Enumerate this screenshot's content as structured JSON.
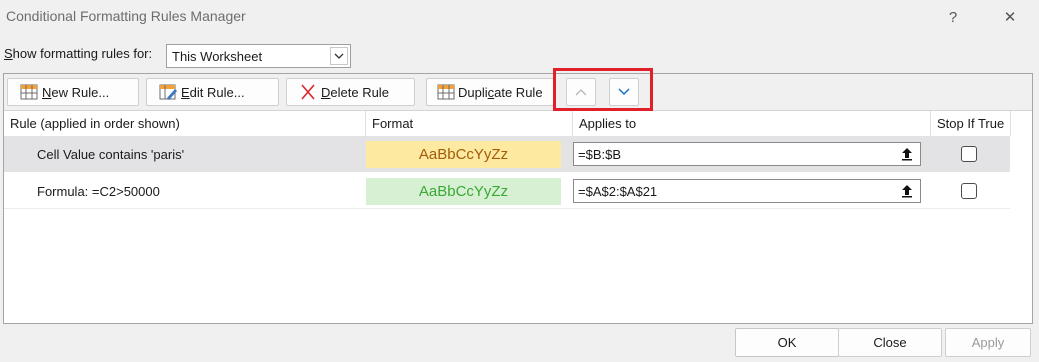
{
  "window": {
    "title": "Conditional Formatting Rules Manager",
    "help_label": "?",
    "close_label": "✕"
  },
  "scope": {
    "label_prefix": "",
    "label_accel": "S",
    "label_rest": "how formatting rules for:",
    "selected": "This Worksheet"
  },
  "toolbar": {
    "new_rule": {
      "accel": "N",
      "rest": "ew Rule..."
    },
    "edit_rule": {
      "accel": "E",
      "rest": "dit Rule..."
    },
    "delete_rule": {
      "accel": "D",
      "rest": "elete Rule"
    },
    "duplicate_rule": {
      "pre": "Dupli",
      "accel": "c",
      "rest": "ate Rule"
    }
  },
  "table": {
    "headers": {
      "rule": "Rule (applied in order shown)",
      "format": "Format",
      "applies_to": "Applies to",
      "stop": "Stop If True"
    },
    "rows": [
      {
        "rule": "Cell Value contains 'paris'",
        "format_preview": "AaBbCcYyZz",
        "applies_to": "=$B:$B",
        "stop_if_true": false
      },
      {
        "rule": "Formula: =C2>50000",
        "format_preview": "AaBbCcYyZz",
        "applies_to": "=$A$2:$A$21",
        "stop_if_true": false
      }
    ]
  },
  "footer": {
    "ok": "OK",
    "close": "Close",
    "apply": "Apply"
  },
  "colors": {
    "highlight_box": "#e0202a",
    "row1_preview_bg": "#fde9a0",
    "row1_preview_text": "#a35b0a",
    "row2_preview_bg": "#d7f0d3",
    "row2_preview_text": "#3aa835",
    "selected_row_bg": "#e3e3e6",
    "arrow_icon": "#1a73c8"
  },
  "icons": {
    "new_rule": "grid-new-icon",
    "edit_rule": "grid-edit-icon",
    "delete_rule": "red-x-icon",
    "duplicate_rule": "grid-duplicate-icon",
    "move_up": "chevron-up-icon",
    "move_down": "chevron-down-icon",
    "collapse": "collapse-dialog-icon"
  }
}
